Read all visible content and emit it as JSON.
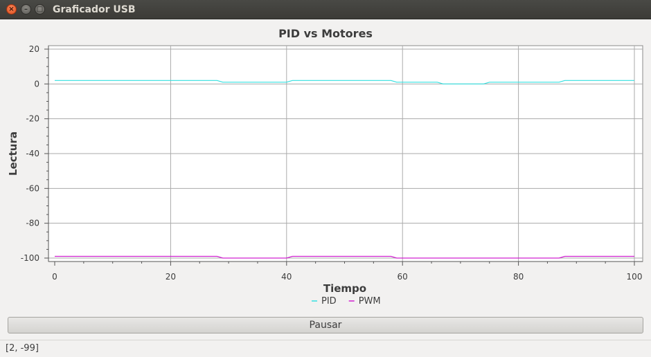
{
  "window": {
    "title": "Graficador USB",
    "close_glyph": "×",
    "min_glyph": "–",
    "max_glyph": "□"
  },
  "chart_data": {
    "type": "line",
    "title": "PID vs Motores",
    "xlabel": "Tiempo",
    "ylabel": "Lectura",
    "xlim": [
      0,
      100
    ],
    "ylim": [
      -100,
      20
    ],
    "xticks": [
      0,
      20,
      40,
      60,
      80,
      100
    ],
    "yticks": [
      20,
      0,
      -20,
      -40,
      -60,
      -80,
      -100
    ],
    "grid": true,
    "legend_position": "bottom-center",
    "series": [
      {
        "name": "PID",
        "color": "#33e0e0",
        "points": [
          [
            0,
            2
          ],
          [
            28,
            2
          ],
          [
            29,
            1
          ],
          [
            40,
            1
          ],
          [
            41,
            2
          ],
          [
            58,
            2
          ],
          [
            59,
            1
          ],
          [
            66,
            1
          ],
          [
            67,
            0
          ],
          [
            74,
            0
          ],
          [
            75,
            1
          ],
          [
            87,
            1
          ],
          [
            88,
            2
          ],
          [
            100,
            2
          ]
        ]
      },
      {
        "name": "PWM",
        "color": "#d020d0",
        "points": [
          [
            0,
            -99
          ],
          [
            28,
            -99
          ],
          [
            29,
            -100
          ],
          [
            40,
            -100
          ],
          [
            41,
            -99
          ],
          [
            58,
            -99
          ],
          [
            59,
            -100
          ],
          [
            87,
            -100
          ],
          [
            88,
            -99
          ],
          [
            100,
            -99
          ]
        ]
      }
    ]
  },
  "controls": {
    "pause_label": "Pausar"
  },
  "status": {
    "text": "[2, -99]"
  }
}
